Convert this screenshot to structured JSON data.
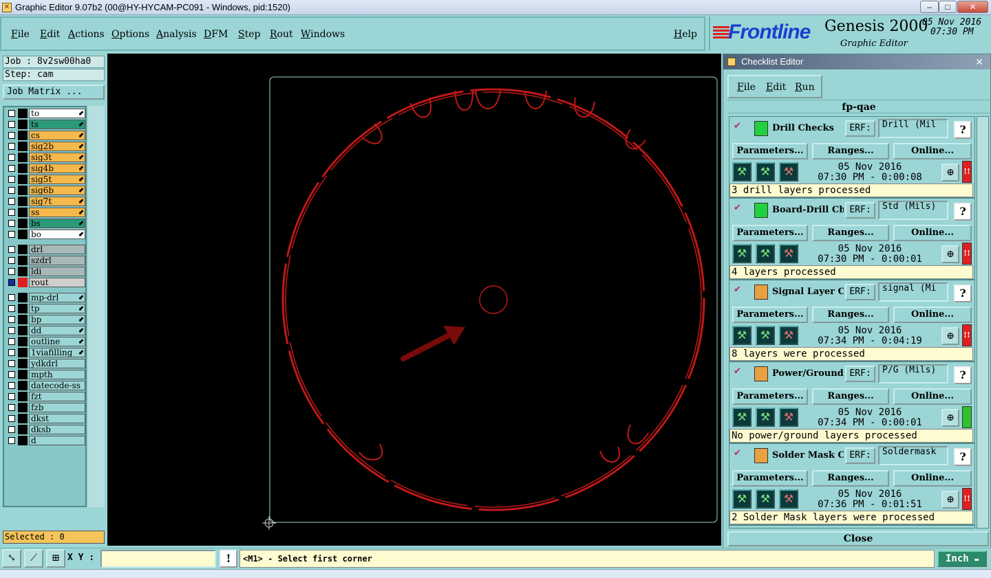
{
  "window": {
    "title": "Graphic Editor 9.07b2 (00@HY-HYCAM-PC091 - Windows, pid:1520)"
  },
  "menu": {
    "items": [
      "File",
      "Edit",
      "Actions",
      "Options",
      "Analysis",
      "DFM",
      "Step",
      "Rout",
      "Windows"
    ],
    "help": "Help"
  },
  "brand": {
    "logo": "Frontline",
    "product": "Genesis 2000",
    "subtitle": "Graphic Editor",
    "date": "05 Nov 2016",
    "time": "07:30 PM"
  },
  "job": {
    "job_label": "Job : 8v2sw00ha0",
    "step_label": "Step: cam",
    "matrix_button": "Job Matrix ..."
  },
  "layers": [
    {
      "name": "to",
      "bg": "#ffffff"
    },
    {
      "name": "ts",
      "bg": "#2a9a7a"
    },
    {
      "name": "cs",
      "bg": "#f5b84a"
    },
    {
      "name": "sig2b",
      "bg": "#f5b84a"
    },
    {
      "name": "sig3t",
      "bg": "#f5b84a"
    },
    {
      "name": "sig4b",
      "bg": "#f5b84a"
    },
    {
      "name": "sig5t",
      "bg": "#f5b84a"
    },
    {
      "name": "sig6b",
      "bg": "#f5b84a"
    },
    {
      "name": "sig7t",
      "bg": "#f5b84a"
    },
    {
      "name": "ss",
      "bg": "#f5b84a"
    },
    {
      "name": "bs",
      "bg": "#2a9a7a"
    },
    {
      "name": "bo",
      "bg": "#ffffff"
    },
    {
      "name": "drl",
      "bg": "#a7b8b8"
    },
    {
      "name": "szdrl",
      "bg": "#a7b8b8"
    },
    {
      "name": "ldi",
      "bg": "#a7b8b8"
    },
    {
      "name": "rout",
      "bg": "#cfcfcf"
    },
    {
      "name": "mp-drl",
      "bg": "#9bd5d5"
    },
    {
      "name": "tp",
      "bg": "#9bd5d5"
    },
    {
      "name": "bp",
      "bg": "#9bd5d5"
    },
    {
      "name": "dd",
      "bg": "#9bd5d5"
    },
    {
      "name": "outline",
      "bg": "#9bd5d5"
    },
    {
      "name": "1viafilling",
      "bg": "#9bd5d5"
    },
    {
      "name": "ydkdrl",
      "bg": "#9bd5d5"
    },
    {
      "name": "mpth",
      "bg": "#9bd5d5"
    },
    {
      "name": "datecode-ss",
      "bg": "#9bd5d5"
    },
    {
      "name": "fzt",
      "bg": "#9bd5d5"
    },
    {
      "name": "fzb",
      "bg": "#9bd5d5"
    },
    {
      "name": "dkst",
      "bg": "#9bd5d5"
    },
    {
      "name": "dksb",
      "bg": "#9bd5d5"
    },
    {
      "name": "d",
      "bg": "#9bd5d5"
    }
  ],
  "selected": "Selected : 0",
  "checklist": {
    "title": "Checklist Editor",
    "menu": [
      "File",
      "Edit",
      "Run"
    ],
    "name": "fp-qae",
    "close": "Close",
    "params_label": "Parameters...",
    "ranges_label": "Ranges...",
    "online_label": "Online...",
    "erf_label": "ERF:",
    "actions": [
      {
        "name": "Drill Checks",
        "erf": "Drill (Mil",
        "date": "05 Nov 2016",
        "time": "07:30 PM - 0:00:08",
        "result": "3 drill layers processed",
        "status": "#e02020",
        "icon_color": "#20d040"
      },
      {
        "name": "Board-Drill Checks",
        "erf": "Std (Mils)",
        "date": "05 Nov 2016",
        "time": "07:30 PM - 0:00:01",
        "result": "4 layers processed",
        "status": "#e02020",
        "icon_color": "#20d040"
      },
      {
        "name": "Signal Layer Checks",
        "erf": "signal (Mi",
        "date": "05 Nov 2016",
        "time": "07:34 PM - 0:04:19",
        "result": "8 layers were processed",
        "status": "#e02020",
        "icon_color": "#e8a040"
      },
      {
        "name": "Power/Ground Checks",
        "erf": "P/G (Mils)",
        "date": "05 Nov 2016",
        "time": "07:34 PM - 0:00:01",
        "result": "No power/ground layers processed",
        "status": "#30c030",
        "icon_color": "#e8a040"
      },
      {
        "name": "Solder Mask Checks",
        "erf": "Soldermask",
        "date": "05 Nov 2016",
        "time": "07:36 PM - 0:01:51",
        "result": "2 Solder Mask layers were processed",
        "status": "#e02020",
        "icon_color": "#e8a040"
      }
    ]
  },
  "statusbar": {
    "xy_label": "X Y :",
    "prompt": "<M1> - Select first corner",
    "units": "Inch"
  }
}
